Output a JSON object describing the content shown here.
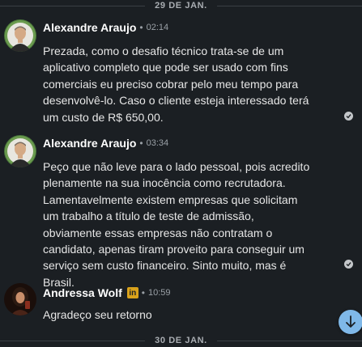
{
  "dates": {
    "top": "29 DE JAN.",
    "bottom": "30 DE JAN."
  },
  "messages": [
    {
      "sender": "Alexandre Araujo",
      "dot": "•",
      "time": "02:14",
      "text": "Prezada, como o desafio técnico trata-se de um aplicativo completo que pode ser usado com fins comerciais eu preciso cobrar pelo meu tempo para desenvolvê-lo. Caso o cliente esteja interessado terá um custo de R$ 650,00."
    },
    {
      "sender": "Alexandre Araujo",
      "dot": "•",
      "time": "03:34",
      "text": "Peço que não leve para o lado pessoal, pois acredito plenamente na sua inocência como recrutadora. Lamentavelmente existem empresas que solicitam um trabalho a título de teste de admissão, obviamente essas empresas não contratam o candidato, apenas tiram proveito para conseguir um serviço sem custo financeiro. Sinto muito, mas é Brasil."
    },
    {
      "sender": "Andressa Wolf",
      "badge": "in",
      "dot": "•",
      "time": "10:59",
      "text": "Agradeço seu retorno"
    }
  ],
  "icons": {
    "read_receipt": "check-circle-icon",
    "scroll_down": "arrow-down-icon",
    "linkedin_premium": "linkedin-badge-icon"
  },
  "colors": {
    "background": "#1b1f23",
    "scroll_button": "#7fb8e8",
    "premium_badge": "#d9a21b"
  }
}
